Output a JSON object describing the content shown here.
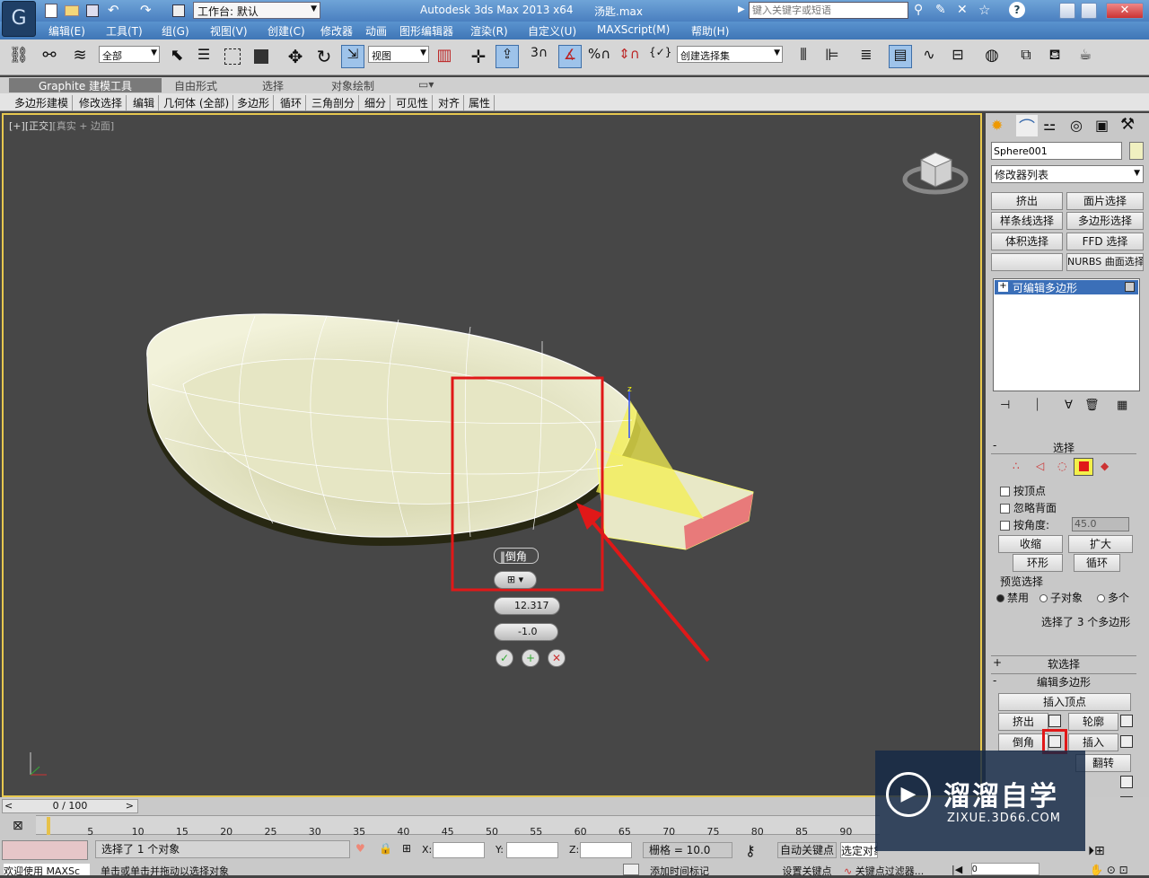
{
  "titlebar": {
    "workspace_label": "工作台: 默认",
    "app_title": "Autodesk 3ds Max  2013 x64",
    "file_name": "汤匙.max",
    "search_placeholder": "键入关键字或短语"
  },
  "menu": [
    "编辑(E)",
    "工具(T)",
    "组(G)",
    "视图(V)",
    "创建(C)",
    "修改器",
    "动画",
    "图形编辑器",
    "渲染(R)",
    "自定义(U)",
    "MAXScript(M)",
    "帮助(H)"
  ],
  "toolbar": {
    "selection_filter": "全部",
    "ref_coord": "视图",
    "snap_label": "3",
    "named_selection": "创建选择集"
  },
  "ribbon": {
    "tabs": [
      "Graphite 建模工具",
      "自由形式",
      "选择",
      "对象绘制"
    ],
    "subtabs": [
      "多边形建模",
      "修改选择",
      "编辑",
      "几何体 (全部)",
      "多边形",
      "循环",
      "三角剖分",
      "细分",
      "可见性",
      "对齐",
      "属性"
    ]
  },
  "viewport": {
    "label_parts": [
      "[+]",
      "[正交]",
      "[真实 + 边面]"
    ],
    "axis_z": "z"
  },
  "caddy": {
    "title": "倒角",
    "height_value": "12.317",
    "outline_value": "-1.0"
  },
  "cmdpanel": {
    "object_name": "Sphere001",
    "modifier_list": "修改器列表",
    "buttons": [
      "挤出",
      "面片选择",
      "样条线选择",
      "多边形选择",
      "体积选择",
      "FFD 选择",
      "",
      "NURBS 曲面选择"
    ],
    "stack_item": "可编辑多边形",
    "selection_rollout": "选择",
    "by_vertex": "按顶点",
    "ignore_backfacing": "忽略背面",
    "by_angle": "按角度:",
    "angle_value": "45.0",
    "shrink": "收缩",
    "grow": "扩大",
    "ring": "环形",
    "loop": "循环",
    "preview_label": "预览选择",
    "preview_opts": [
      "禁用",
      "子对象",
      "多个"
    ],
    "selected_info": "选择了 3 个多边形",
    "soft_selection": "软选择",
    "edit_polygons": "编辑多边形",
    "insert_vertex": "插入顶点",
    "extrude": "挤出",
    "outline": "轮廓",
    "bevel": "倒角",
    "inset": "插入",
    "flip": "翻转",
    "subdivide_partial": "分"
  },
  "timeline": {
    "frame": "0 / 100",
    "ticks": [
      "0",
      "5",
      "10",
      "15",
      "20",
      "25",
      "30",
      "35",
      "40",
      "45",
      "50",
      "55",
      "60",
      "65",
      "70",
      "75",
      "80",
      "85",
      "90"
    ]
  },
  "status": {
    "selected": "选择了 1 个对象",
    "prompt": "单击或单击并拖动以选择对象",
    "welcome": "欢迎使用 MAXSc",
    "x_label": "X:",
    "y_label": "Y:",
    "z_label": "Z:",
    "grid": "栅格 = 10.0",
    "add_time_tag": "添加时间标记",
    "auto_key": "自动关键点",
    "set_key": "设置关键点",
    "selected_obj": "选定对象",
    "key_filters": "关键点过滤器...",
    "frame_value": "0"
  },
  "watermark": {
    "brand": "溜溜自学",
    "url": "ZIXUE.3D66.COM"
  },
  "colors": {
    "titlebar": "#5b93cf",
    "highlight_red": "#e01818",
    "selected_yellow": "#f3f04a"
  }
}
